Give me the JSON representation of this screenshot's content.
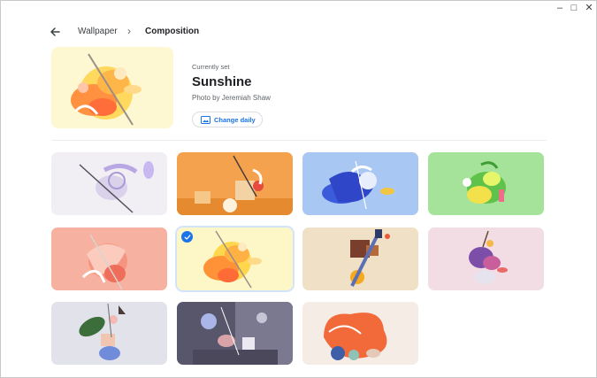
{
  "window": {
    "controls": {
      "minimize": "–",
      "maximize": "□",
      "close": "✕"
    }
  },
  "header": {
    "back_icon": "arrow-back-icon",
    "breadcrumb": [
      "Wallpaper",
      "Composition"
    ],
    "separator_icon": "chevron-right-icon"
  },
  "current": {
    "label": "Currently set",
    "title": "Sunshine",
    "credit": "Photo by Jeremiah Shaw",
    "change_daily_label": "Change daily",
    "change_daily_icon": "photo-icon"
  },
  "grid": {
    "selected_index": 5,
    "check_icon": "check-icon",
    "tiles": [
      {
        "name": "wallpaper-white-lilac"
      },
      {
        "name": "wallpaper-orange-shapes"
      },
      {
        "name": "wallpaper-blue-swirl"
      },
      {
        "name": "wallpaper-green-splash"
      },
      {
        "name": "wallpaper-coral-ribbons"
      },
      {
        "name": "wallpaper-sunshine"
      },
      {
        "name": "wallpaper-beige-blocks"
      },
      {
        "name": "wallpaper-pink-petals"
      },
      {
        "name": "wallpaper-grey-leaf"
      },
      {
        "name": "wallpaper-slate-objects"
      },
      {
        "name": "wallpaper-orange-blob"
      }
    ]
  }
}
